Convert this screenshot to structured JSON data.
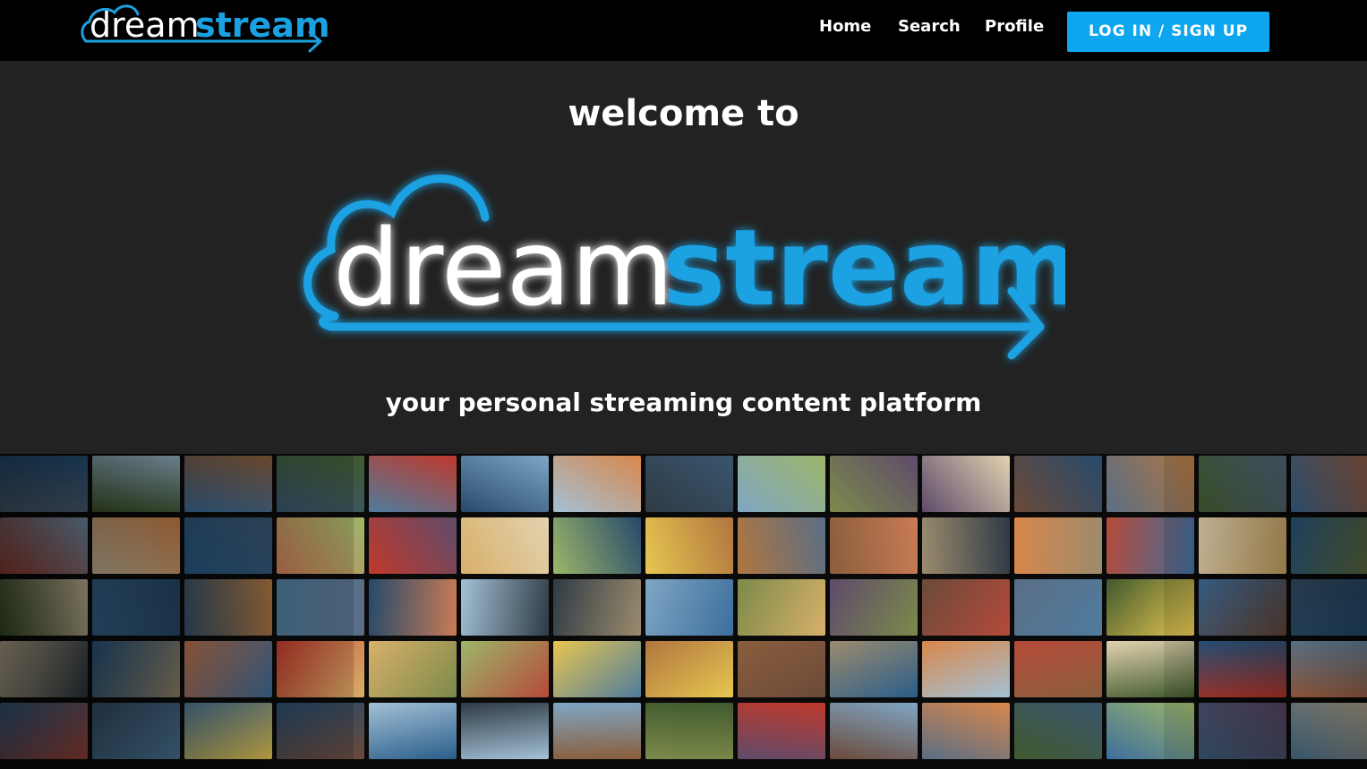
{
  "brand": {
    "logo_light": "dream",
    "logo_accent": "stream",
    "accent_color": "#1ba1e2"
  },
  "nav": {
    "items": [
      {
        "label": "Home"
      },
      {
        "label": "Search"
      },
      {
        "label": "Profile"
      }
    ],
    "login_label": "LOG IN / SIGN UP",
    "login_color": "#0ea6ee"
  },
  "hero": {
    "welcome": "welcome to",
    "tagline": "your personal streaming content platform"
  },
  "mosaic": {
    "icon": "photo-wall",
    "tile_colors": [
      "#5a6e86",
      "#c97b55",
      "#2f3b45",
      "#9b8b6d",
      "#3d6e9c",
      "#d8b06a",
      "#7c8a4a",
      "#b54a3a",
      "#4f7c9e",
      "#e7c650",
      "#6b4a3a",
      "#2a5d8a",
      "#a3c1d6",
      "#8a5e3c",
      "#415a2e",
      "#c0392b",
      "#7fa6c4",
      "#d9874a",
      "#39556e",
      "#9db66a",
      "#5e4b6b",
      "#e2d2b0",
      "#264a6b",
      "#b0763f"
    ]
  }
}
